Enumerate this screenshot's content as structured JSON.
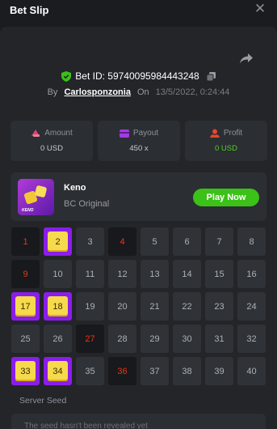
{
  "header": {
    "title": "Bet Slip",
    "close_icon": "close-icon"
  },
  "bet": {
    "id_label": "Bet ID: 59740095984443248",
    "by_label": "By",
    "username": "Carlosponzonia",
    "on_label": "On",
    "date": "13/5/2022, 0:24:44"
  },
  "stats": [
    {
      "label": "Amount",
      "value": "0 USD",
      "icon": "amount-icon",
      "color": "#d9466e"
    },
    {
      "label": "Payout",
      "value": "450 x",
      "icon": "payout-icon",
      "color": "#a23be3"
    },
    {
      "label": "Profit",
      "value": "0 USD",
      "icon": "profit-icon",
      "color": "#e8452c"
    }
  ],
  "game": {
    "name": "Keno",
    "provider": "BC Original",
    "play_label": "Play Now",
    "thumb_label": "KENO"
  },
  "grid": {
    "cells": [
      {
        "n": "1",
        "s": "miss"
      },
      {
        "n": "2",
        "s": "hit"
      },
      {
        "n": "3",
        "s": ""
      },
      {
        "n": "4",
        "s": "miss"
      },
      {
        "n": "5",
        "s": ""
      },
      {
        "n": "6",
        "s": ""
      },
      {
        "n": "7",
        "s": ""
      },
      {
        "n": "8",
        "s": ""
      },
      {
        "n": "9",
        "s": "miss"
      },
      {
        "n": "10",
        "s": ""
      },
      {
        "n": "11",
        "s": ""
      },
      {
        "n": "12",
        "s": ""
      },
      {
        "n": "13",
        "s": ""
      },
      {
        "n": "14",
        "s": ""
      },
      {
        "n": "15",
        "s": ""
      },
      {
        "n": "16",
        "s": ""
      },
      {
        "n": "17",
        "s": "hit"
      },
      {
        "n": "18",
        "s": "hit"
      },
      {
        "n": "19",
        "s": ""
      },
      {
        "n": "20",
        "s": ""
      },
      {
        "n": "21",
        "s": ""
      },
      {
        "n": "22",
        "s": ""
      },
      {
        "n": "23",
        "s": ""
      },
      {
        "n": "24",
        "s": ""
      },
      {
        "n": "25",
        "s": ""
      },
      {
        "n": "26",
        "s": ""
      },
      {
        "n": "27",
        "s": "miss"
      },
      {
        "n": "28",
        "s": ""
      },
      {
        "n": "29",
        "s": ""
      },
      {
        "n": "30",
        "s": ""
      },
      {
        "n": "31",
        "s": ""
      },
      {
        "n": "32",
        "s": ""
      },
      {
        "n": "33",
        "s": "hit"
      },
      {
        "n": "34",
        "s": "hit"
      },
      {
        "n": "35",
        "s": ""
      },
      {
        "n": "36",
        "s": "miss"
      },
      {
        "n": "37",
        "s": ""
      },
      {
        "n": "38",
        "s": ""
      },
      {
        "n": "39",
        "s": ""
      },
      {
        "n": "40",
        "s": ""
      }
    ]
  },
  "seed": {
    "label": "Server Seed",
    "text": "The seed hasn't been revealed yet"
  },
  "colors": {
    "accent_green": "#3bc117",
    "hit_purple": "#8a1ee8",
    "hit_yellow": "#f6d94d",
    "miss_red": "#e6361d"
  }
}
